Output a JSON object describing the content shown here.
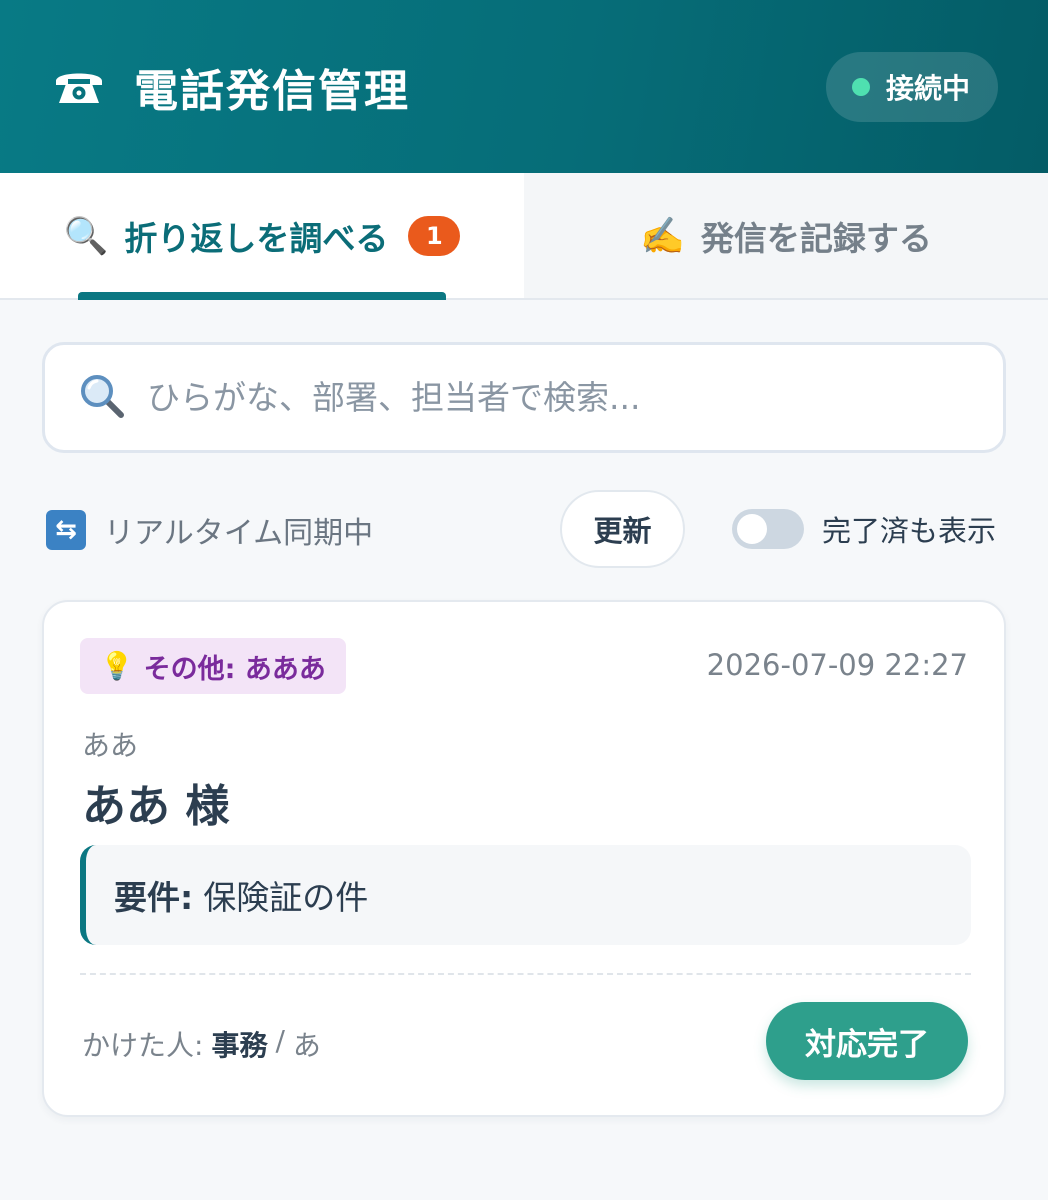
{
  "header": {
    "title": "電話発信管理",
    "icon": "telephone-icon",
    "status": "接続中",
    "status_color": "#4fe0b0"
  },
  "tabs": [
    {
      "label": "折り返しを調べる",
      "icon": "magnifier-icon",
      "badge": "1",
      "active": true
    },
    {
      "label": "発信を記録する",
      "icon": "writing-hand-icon",
      "active": false
    }
  ],
  "search": {
    "placeholder": "ひらがな、部署、担当者で検索..."
  },
  "controls": {
    "sync_label": "リアルタイム同期中",
    "refresh_label": "更新",
    "toggle_label": "完了済も表示",
    "toggle_on": false
  },
  "card": {
    "category": "その他: あああ",
    "category_icon": "lightbulb-icon",
    "timestamp": "2026-07-09 22:27",
    "kana": "ああ",
    "name": "ああ 様",
    "subject_label": "要件:",
    "subject_text": "保険証の件",
    "caller_label": "かけた人:",
    "caller_dept": "事務",
    "caller_sep": "/",
    "caller_name": "あ",
    "done_label": "対応完了"
  },
  "colors": {
    "header": "#087a85",
    "accent": "#0b7782",
    "badge": "#ea5a1c",
    "done_button": "#2e9f8c",
    "category_bg": "#f3e4f7",
    "category_text": "#7a2b9c"
  }
}
